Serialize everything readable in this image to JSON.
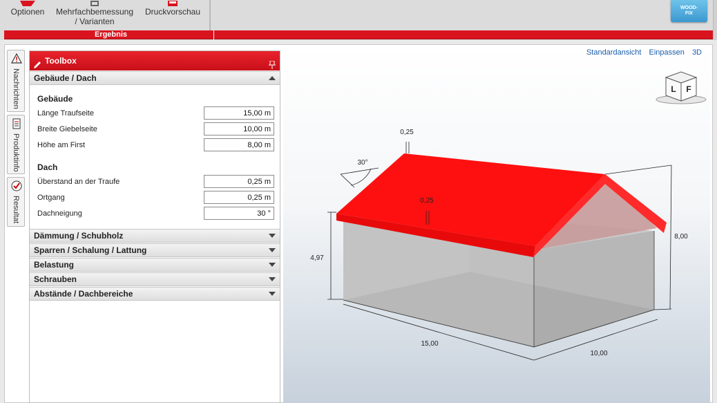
{
  "ribbon": {
    "buttons": [
      {
        "label": "Optionen"
      },
      {
        "label": "Mehrfachbemessung",
        "label2": "/ Varianten"
      },
      {
        "label": "Druckvorschau"
      }
    ],
    "group_label": "Ergebnis",
    "logo_line1": "WOOD-",
    "logo_line2": "FIX"
  },
  "sidetabs": [
    {
      "label": "Nachrichten",
      "icon": "warning-icon"
    },
    {
      "label": "Produktinfo",
      "icon": "document-icon"
    },
    {
      "label": "Resultat",
      "icon": "check-icon"
    }
  ],
  "toolbox": {
    "title": "Toolbox",
    "sections": [
      {
        "title": "Gebäude / Dach",
        "expanded": true
      },
      {
        "title": "Dämmung / Schubholz"
      },
      {
        "title": "Sparren / Schalung / Lattung"
      },
      {
        "title": "Belastung"
      },
      {
        "title": "Schrauben"
      },
      {
        "title": "Abstände / Dachbereiche"
      }
    ],
    "gebaeude": {
      "title": "Gebäude",
      "fields": [
        {
          "label": "Länge Traufseite",
          "value": "15,00 m"
        },
        {
          "label": "Breite Giebelseite",
          "value": "10,00 m"
        },
        {
          "label": "Höhe am First",
          "value": "8,00 m"
        }
      ]
    },
    "dach": {
      "title": "Dach",
      "fields": [
        {
          "label": "Überstand an der Traufe",
          "value": "0,25 m"
        },
        {
          "label": "Ortgang",
          "value": "0,25 m"
        },
        {
          "label": "Dachneigung",
          "value": "30 °"
        }
      ]
    }
  },
  "viewport": {
    "links": [
      "Standardansicht",
      "Einpassen",
      "3D"
    ],
    "cube": {
      "left": "L",
      "front": "F"
    },
    "dims": {
      "overhang_top": "0,25",
      "angle": "30°",
      "overhang_mid": "0,25",
      "wall_height": "4,97",
      "ridge_height": "8,00",
      "length": "15,00",
      "width": "10,00"
    },
    "colors": {
      "roof": "#ff0000",
      "walls": "#b8b8b8"
    }
  }
}
